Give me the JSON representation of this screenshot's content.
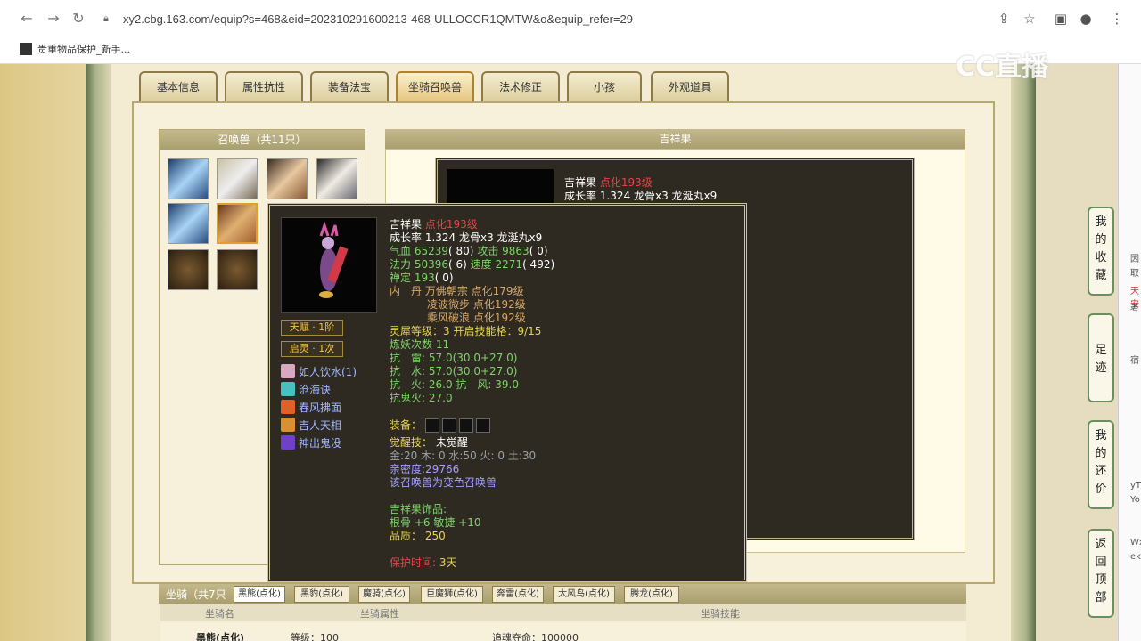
{
  "browser": {
    "url": "xy2.cbg.163.com/equip?s=468&eid=202310291600213-468-ULLOCCR1QMTW&o&equip_refer=29",
    "bookmark": "贵重物品保护_新手..."
  },
  "watermark": "CC直播",
  "tabs": [
    {
      "label": "基本信息"
    },
    {
      "label": "属性抗性"
    },
    {
      "label": "装备法宝"
    },
    {
      "label": "坐骑召唤兽"
    },
    {
      "label": "法术修正"
    },
    {
      "label": "小孩"
    },
    {
      "label": "外观道具"
    }
  ],
  "pet_panel": {
    "title": "召唤兽（共11只）"
  },
  "detail": {
    "title": "吉祥果"
  },
  "back_card": {
    "name": "吉祥果",
    "level": "点化193级",
    "growth": "成长率 1.324 龙骨x3 龙涎丸x9"
  },
  "tooltip": {
    "name": "吉祥果",
    "level": "点化193级",
    "growth": "成长率 1.324 龙骨x3 龙涎丸x9",
    "hp_label": "气血",
    "hp_value": "65239",
    "hp_extra": "( 80)",
    "atk_label": "攻击",
    "atk_value": "9863",
    "atk_extra": "( 0)",
    "mp_label": "法力",
    "mp_value": "50396",
    "mp_extra": "( 6)",
    "spd_label": "速度",
    "spd_value": "2271",
    "spd_extra": "( 492)",
    "zen_label": "禅定",
    "zen_value": "193",
    "zen_extra": "( 0)",
    "inner_label": "内　丹",
    "inner_1": "万佛朝宗 点化179级",
    "inner_2": "凌波微步 点化192级",
    "inner_3": "乘风破浪 点化192级",
    "spirit_label": "灵犀等级：",
    "spirit_value": "3 开启技能格：9/15",
    "demon_label": "炼妖次数",
    "demon_value": "11",
    "res_1a": "抗　雷: ",
    "res_1b": "57.0(30.0+27.0)",
    "res_2a": "抗　水: ",
    "res_2b": "57.0(30.0+27.0)",
    "res_3a": "抗　火: ",
    "res_3b": "26.0 抗　风: 39.0",
    "res_4a": "抗鬼火: ",
    "res_4b": "27.0",
    "equip_label": "装备：",
    "awaken_label": "觉醒技：",
    "awaken_value": "未觉醒",
    "elements": "金:20 木: 0 水:50 火: 0 土:30",
    "intimacy": "亲密度:29766",
    "variant": "该召唤兽为变色召唤兽",
    "ornament_title": "吉祥果饰品:",
    "ornament_stats": "根骨 +6 敏捷 +10",
    "quality": "品质：  250",
    "protect_label": "保护时间:",
    "protect_value": "3天",
    "talent": "天赋 · 1阶",
    "qiling": "启灵 · 1次",
    "skills": [
      {
        "name": "如人饮水(1)"
      },
      {
        "name": "沧海诀"
      },
      {
        "name": "春风拂面"
      },
      {
        "name": "吉人天相"
      },
      {
        "name": "神出鬼没"
      }
    ]
  },
  "float_menu": [
    {
      "label": "我的收藏"
    },
    {
      "label": "足迹"
    },
    {
      "label": "我的还价"
    },
    {
      "label": "返回顶部"
    }
  ],
  "far_right": [
    "因",
    "取",
    "天安",
    "考",
    "宿",
    "yT",
    "Yo",
    "Wx",
    "ek"
  ],
  "mount": {
    "title": "坐骑（共7只",
    "tabs": [
      {
        "label": "黑熊(点化)"
      },
      {
        "label": "黑豹(点化)"
      },
      {
        "label": "魔骑(点化)"
      },
      {
        "label": "巨魔狮(点化)"
      },
      {
        "label": "奔雷(点化)"
      },
      {
        "label": "大风鸟(点化)"
      },
      {
        "label": "腾龙(点化)"
      }
    ],
    "col_name": "坐骑名",
    "col_attr": "坐骑属性",
    "col_skill": "坐骑技能",
    "row_name": "黑熊(点化)",
    "row_level": "等级：100",
    "row_skill": "追魂夺命：100000"
  }
}
